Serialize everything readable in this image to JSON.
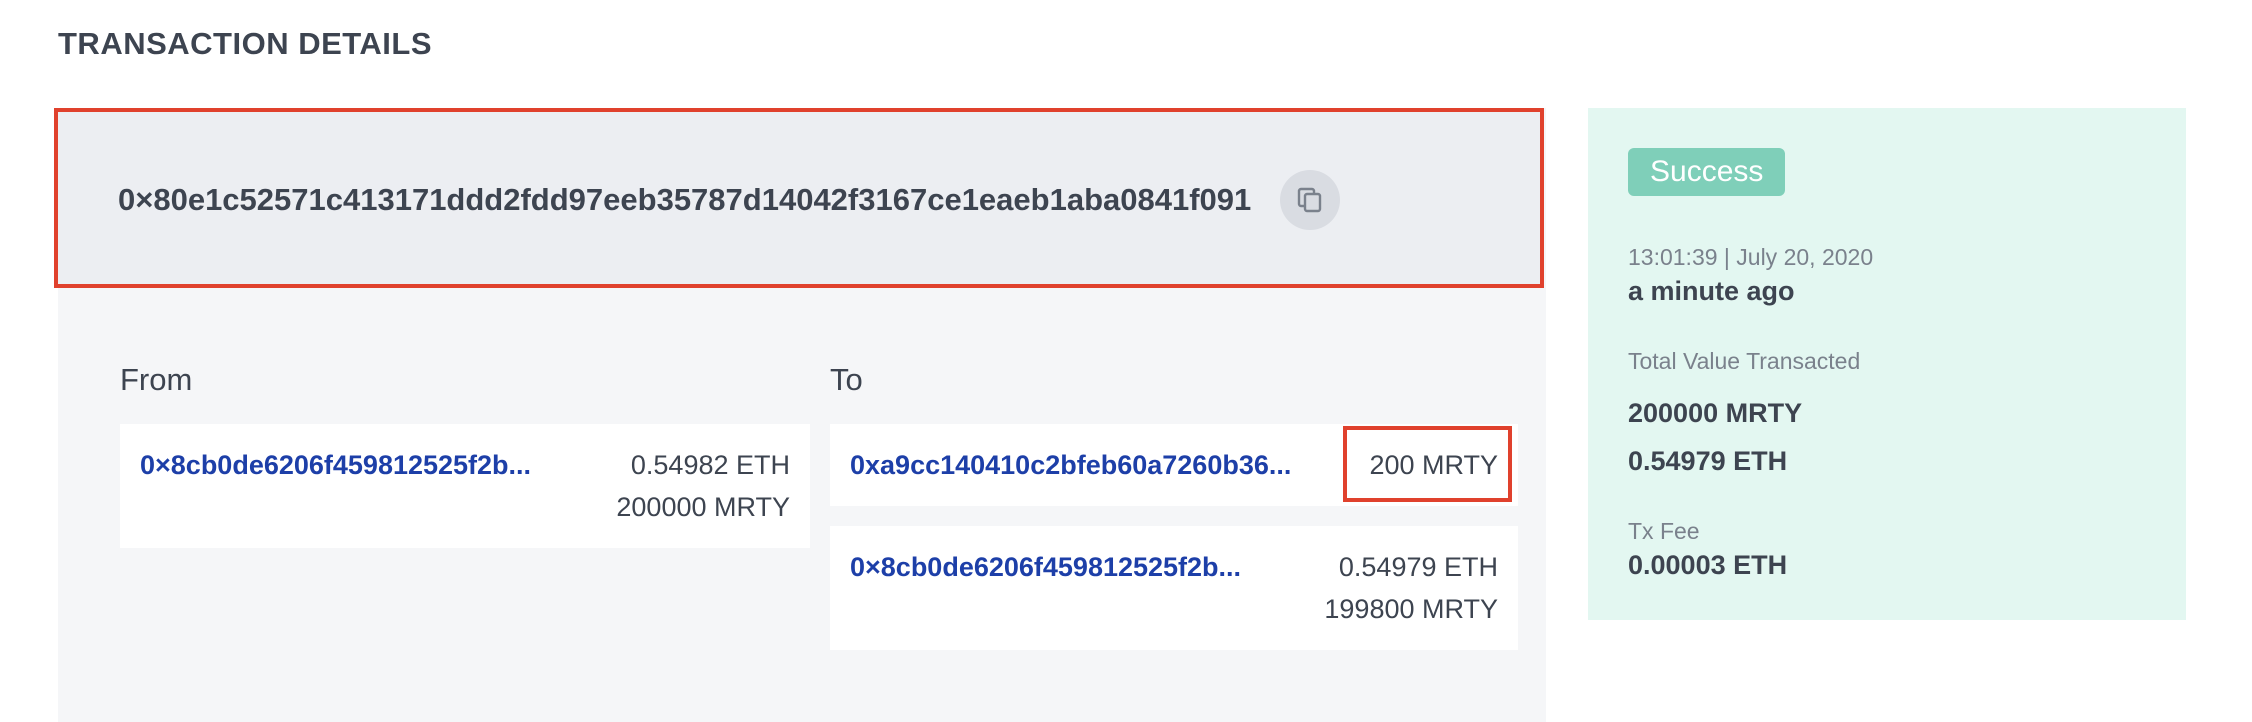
{
  "page": {
    "title": "TRANSACTION DETAILS"
  },
  "transaction": {
    "hash": "0×80e1c52571c413171ddd2fdd97eeb35787d14042f3167ce1eaeb1aba0841f091",
    "copy_icon": "copy-icon"
  },
  "from": {
    "label": "From",
    "entries": [
      {
        "address": "0×8cb0de6206f459812525f2b...",
        "amounts": [
          "0.54982 ETH",
          "200000 MRTY"
        ]
      }
    ]
  },
  "to": {
    "label": "To",
    "entries": [
      {
        "address": "0xa9cc140410c2bfeb60a7260b36...",
        "amounts": [
          "200 MRTY"
        ]
      },
      {
        "address": "0×8cb0de6206f459812525f2b...",
        "amounts": [
          "0.54979 ETH",
          "199800 MRTY"
        ]
      }
    ]
  },
  "summary": {
    "status": "Success",
    "timestamp": "13:01:39 | July 20, 2020",
    "relative_time": "a minute ago",
    "total_label": "Total Value Transacted",
    "total_values": [
      "200000 MRTY",
      "0.54979 ETH"
    ],
    "fee_label": "Tx Fee",
    "fee_value": "0.00003 ETH"
  },
  "colors": {
    "accent_highlight": "#e0412d",
    "link": "#1d3fa8",
    "success_badge": "#7fcfb9",
    "summary_panel": "#e3f7f1"
  }
}
